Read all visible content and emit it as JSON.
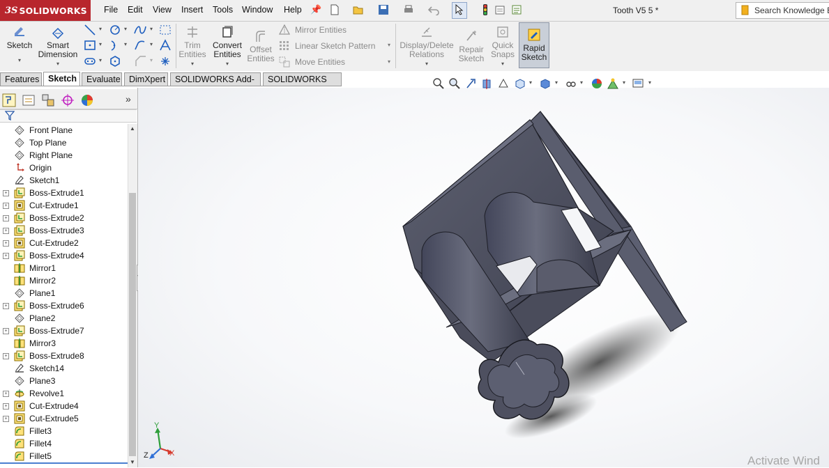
{
  "app": {
    "brand_ds": "3S",
    "brand_name": "SOLIDWORKS",
    "document_title": "Tooth V5 5 *"
  },
  "menu": [
    "File",
    "Edit",
    "View",
    "Insert",
    "Tools",
    "Window",
    "Help"
  ],
  "search": {
    "text": "Search Knowledge Ba"
  },
  "toolbar": {
    "sketch": "Sketch",
    "smart_dimension_1": "Smart",
    "smart_dimension_2": "Dimension",
    "trim_1": "Trim",
    "trim_2": "Entities",
    "convert_1": "Convert",
    "convert_2": "Entities",
    "offset_1": "Offset",
    "offset_2": "Entities",
    "mirror_entities": "Mirror Entities",
    "linear_sketch_pattern": "Linear Sketch Pattern",
    "move_entities": "Move Entities",
    "display_delete_1": "Display/Delete",
    "display_delete_2": "Relations",
    "repair_1": "Repair",
    "repair_2": "Sketch",
    "quick_snaps_1": "Quick",
    "quick_snaps_2": "Snaps",
    "rapid_1": "Rapid",
    "rapid_2": "Sketch"
  },
  "tabs": [
    {
      "label": "Features",
      "active": false
    },
    {
      "label": "Sketch",
      "active": true
    },
    {
      "label": "Evaluate",
      "active": false
    },
    {
      "label": "DimXpert",
      "active": false
    },
    {
      "label": "SOLIDWORKS Add-Ins",
      "active": false
    },
    {
      "label": "SOLIDWORKS MBD",
      "active": false
    }
  ],
  "pane_tabs": [
    "feature-manager-icon",
    "property-manager-icon",
    "configuration-manager-icon",
    "dimxpert-manager-icon",
    "display-manager-icon"
  ],
  "tree": [
    {
      "label": "Front Plane",
      "icon": "plane",
      "expandable": false
    },
    {
      "label": "Top Plane",
      "icon": "plane",
      "expandable": false
    },
    {
      "label": "Right Plane",
      "icon": "plane",
      "expandable": false
    },
    {
      "label": "Origin",
      "icon": "origin",
      "expandable": false
    },
    {
      "label": "Sketch1",
      "icon": "sketch",
      "expandable": false
    },
    {
      "label": "Boss-Extrude1",
      "icon": "boss",
      "expandable": true
    },
    {
      "label": "Cut-Extrude1",
      "icon": "cut",
      "expandable": true
    },
    {
      "label": "Boss-Extrude2",
      "icon": "boss",
      "expandable": true
    },
    {
      "label": "Boss-Extrude3",
      "icon": "boss",
      "expandable": true
    },
    {
      "label": "Cut-Extrude2",
      "icon": "cut",
      "expandable": true
    },
    {
      "label": "Boss-Extrude4",
      "icon": "boss",
      "expandable": true
    },
    {
      "label": "Mirror1",
      "icon": "mirror",
      "expandable": false
    },
    {
      "label": "Mirror2",
      "icon": "mirror",
      "expandable": false
    },
    {
      "label": "Plane1",
      "icon": "plane",
      "expandable": false
    },
    {
      "label": "Boss-Extrude6",
      "icon": "boss",
      "expandable": true
    },
    {
      "label": "Plane2",
      "icon": "plane",
      "expandable": false
    },
    {
      "label": "Boss-Extrude7",
      "icon": "boss",
      "expandable": true
    },
    {
      "label": "Mirror3",
      "icon": "mirror",
      "expandable": false
    },
    {
      "label": "Boss-Extrude8",
      "icon": "boss",
      "expandable": true
    },
    {
      "label": "Sketch14",
      "icon": "sketch",
      "expandable": false
    },
    {
      "label": "Plane3",
      "icon": "plane",
      "expandable": false
    },
    {
      "label": "Revolve1",
      "icon": "revolve",
      "expandable": true
    },
    {
      "label": "Cut-Extrude4",
      "icon": "cut",
      "expandable": true
    },
    {
      "label": "Cut-Extrude5",
      "icon": "cut",
      "expandable": true
    },
    {
      "label": "Fillet3",
      "icon": "fillet",
      "expandable": false
    },
    {
      "label": "Fillet4",
      "icon": "fillet",
      "expandable": false
    },
    {
      "label": "Fillet5",
      "icon": "fillet",
      "expandable": false
    }
  ],
  "triad": {
    "x": "X",
    "y": "Y",
    "z": "Z"
  },
  "watermark": "Activate Wind",
  "colors": {
    "brand": "#b8262d",
    "model": "#4d4f5e",
    "accent": "#1f5fbf"
  }
}
